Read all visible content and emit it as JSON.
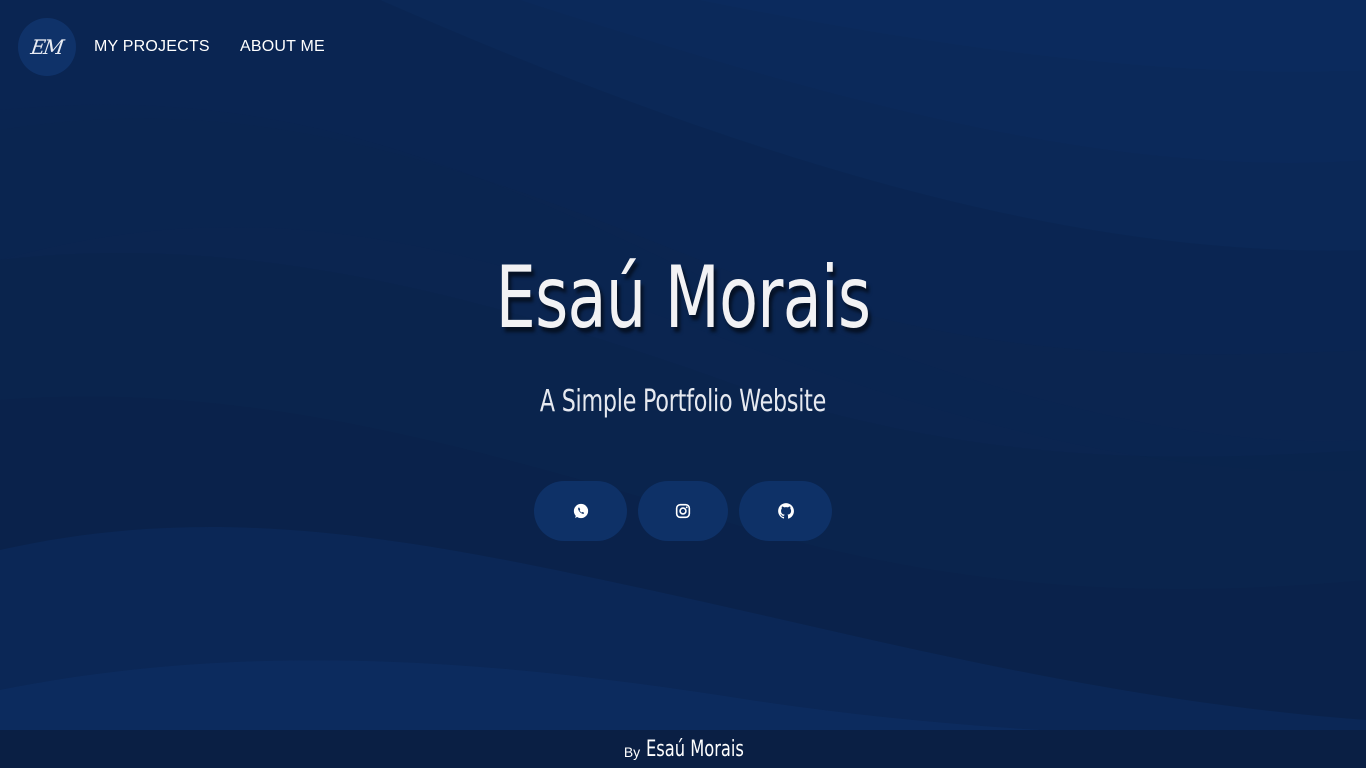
{
  "nav": {
    "logo_text": "EM",
    "links": [
      {
        "label": "MY PROJECTS"
      },
      {
        "label": "ABOUT ME"
      }
    ]
  },
  "hero": {
    "title": "Esaú Morais",
    "subtitle": "A Simple Portfolio Website"
  },
  "social": [
    {
      "icon": "whatsapp-icon"
    },
    {
      "icon": "instagram-icon"
    },
    {
      "icon": "github-icon"
    }
  ],
  "footer": {
    "by_label": "By",
    "author": "Esaú Morais"
  },
  "colors": {
    "background": "#0b2550",
    "wave_light": "#0e3168",
    "wave_dark": "#0a2147",
    "button": "#0e3167",
    "footer": "#0a1f44",
    "text": "#ffffff"
  }
}
